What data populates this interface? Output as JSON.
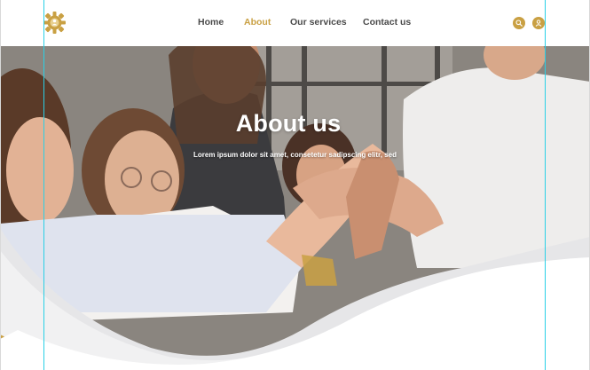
{
  "nav": {
    "items": [
      {
        "label": "Home",
        "active": false
      },
      {
        "label": "About",
        "active": true
      },
      {
        "label": "Our services",
        "active": false
      },
      {
        "label": "Contact us",
        "active": false
      }
    ],
    "icons": [
      "search-icon",
      "user-icon"
    ]
  },
  "hero": {
    "title": "About us",
    "subtitle": "Lorem ipsum dolor sit amet, consetetur sadipscing elitr, sed"
  },
  "colors": {
    "accent": "#c9a043",
    "nav_text": "#4a4a4a",
    "wave_gray": "#e6e6e8",
    "guide": "#29d0e6"
  }
}
